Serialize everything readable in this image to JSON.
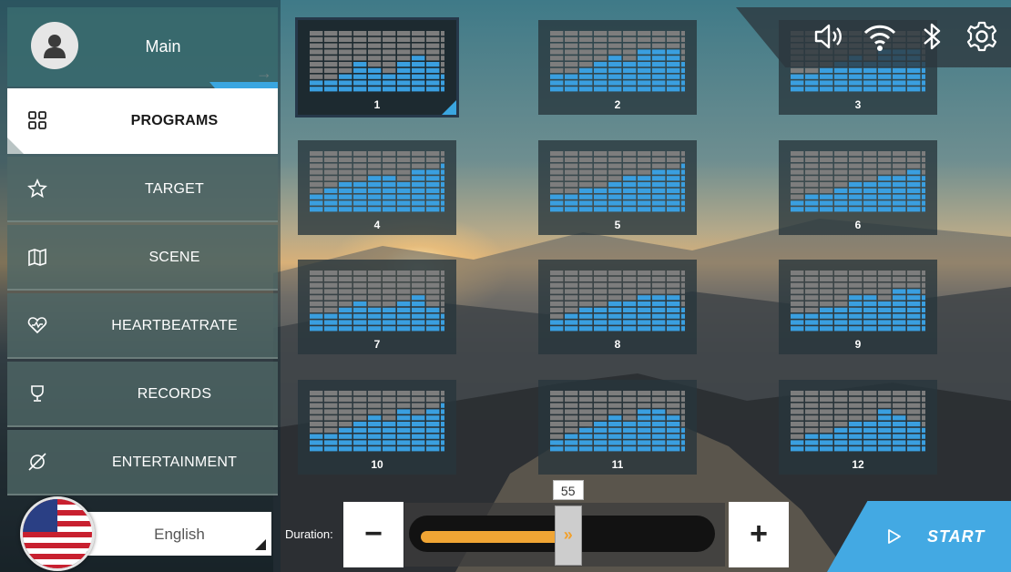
{
  "profile": {
    "name": "Main"
  },
  "nav": {
    "items": [
      {
        "label": "PROGRAMS",
        "icon": "grid-icon",
        "active": true
      },
      {
        "label": "TARGET",
        "icon": "star-icon",
        "active": false
      },
      {
        "label": "SCENE",
        "icon": "map-icon",
        "active": false
      },
      {
        "label": "HEARTBEATRATE",
        "icon": "heart-rate-icon",
        "active": false
      },
      {
        "label": "RECORDS",
        "icon": "trophy-icon",
        "active": false
      },
      {
        "label": "ENTERTAINMENT",
        "icon": "entertainment-icon",
        "active": false
      }
    ]
  },
  "language": {
    "selected": "English",
    "flag": "us-flag-icon"
  },
  "status_icons": [
    "volume-icon",
    "wifi-icon",
    "bluetooth-icon",
    "settings-icon"
  ],
  "programs": [
    {
      "label": "1",
      "levels": [
        2,
        2,
        3,
        5,
        4,
        3,
        5,
        6,
        5,
        3
      ],
      "selected": true
    },
    {
      "label": "2",
      "levels": [
        3,
        3,
        4,
        5,
        6,
        5,
        7,
        7,
        7,
        5
      ],
      "selected": false
    },
    {
      "label": "3",
      "levels": [
        3,
        3,
        4,
        5,
        6,
        5,
        7,
        7,
        7,
        5
      ],
      "selected": false
    },
    {
      "label": "4",
      "levels": [
        3,
        4,
        5,
        5,
        6,
        6,
        5,
        7,
        7,
        8
      ],
      "selected": false
    },
    {
      "label": "5",
      "levels": [
        3,
        3,
        4,
        4,
        5,
        6,
        6,
        7,
        7,
        8
      ],
      "selected": false
    },
    {
      "label": "6",
      "levels": [
        2,
        3,
        3,
        4,
        5,
        5,
        6,
        6,
        7,
        6
      ],
      "selected": false
    },
    {
      "label": "7",
      "levels": [
        3,
        3,
        4,
        5,
        4,
        4,
        5,
        6,
        4,
        3
      ],
      "selected": false
    },
    {
      "label": "8",
      "levels": [
        2,
        3,
        4,
        4,
        5,
        5,
        6,
        6,
        6,
        4
      ],
      "selected": false
    },
    {
      "label": "9",
      "levels": [
        3,
        3,
        4,
        4,
        6,
        6,
        5,
        7,
        7,
        6
      ],
      "selected": false
    },
    {
      "label": "10",
      "levels": [
        3,
        3,
        4,
        5,
        6,
        5,
        7,
        6,
        7,
        8
      ],
      "selected": false
    },
    {
      "label": "11",
      "levels": [
        2,
        3,
        4,
        5,
        6,
        5,
        7,
        7,
        6,
        4
      ],
      "selected": false
    },
    {
      "label": "12",
      "levels": [
        2,
        3,
        3,
        4,
        5,
        5,
        7,
        6,
        5,
        4
      ],
      "selected": false
    }
  ],
  "duration": {
    "label": "Duration:",
    "value": "55",
    "fraction": 0.52,
    "decrease_label": "−",
    "increase_label": "+"
  },
  "start": {
    "label": "START"
  },
  "colors": {
    "accent": "#3aa6e0",
    "slider_fill": "#f0a534",
    "bar_active": "#3a9fe0",
    "bar_inactive": "#7d7d7d"
  }
}
